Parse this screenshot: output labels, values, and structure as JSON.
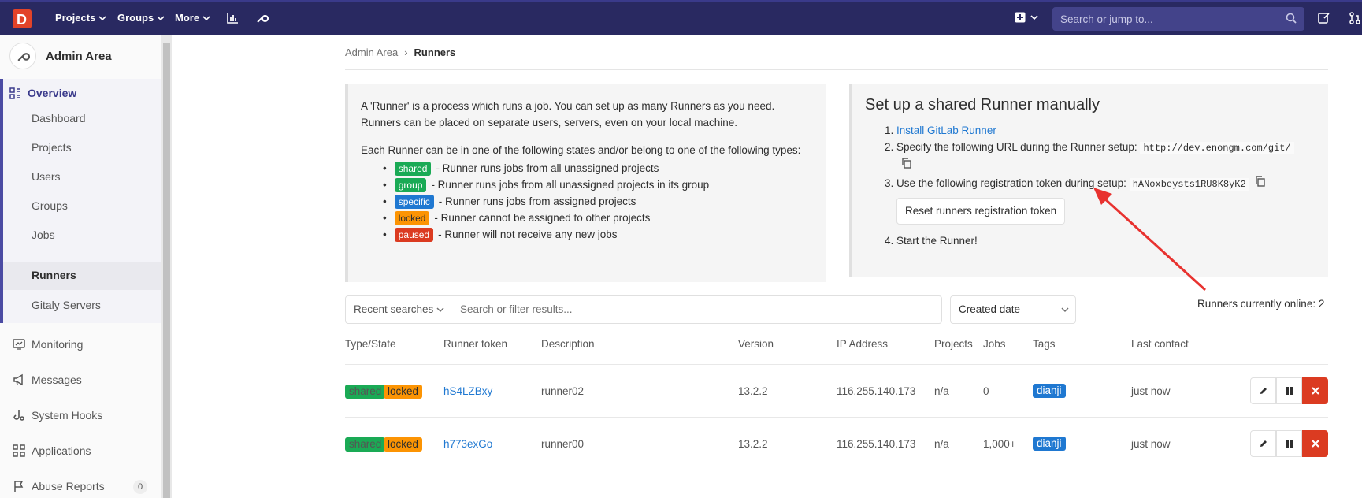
{
  "navbar": {
    "projects": "Projects",
    "groups": "Groups",
    "more": "More",
    "search_placeholder": "Search or jump to..."
  },
  "sidebar": {
    "title": "Admin Area",
    "overview": "Overview",
    "overview_items": [
      "Dashboard",
      "Projects",
      "Users",
      "Groups",
      "Jobs",
      "Runners",
      "Gitaly Servers"
    ],
    "active_item": "Runners",
    "main_items": [
      "Monitoring",
      "Messages",
      "System Hooks",
      "Applications",
      "Abuse Reports"
    ],
    "abuse_count": "0"
  },
  "breadcrumb": {
    "parent": "Admin Area",
    "current": "Runners"
  },
  "info": {
    "p1": "A 'Runner' is a process which runs a job. You can set up as many Runners as you need. Runners can be placed on separate users, servers, even on your local machine.",
    "p2": "Each Runner can be in one of the following states and/or belong to one of the following types:",
    "states": [
      {
        "badge": "shared",
        "text": "- Runner runs jobs from all unassigned projects"
      },
      {
        "badge": "group",
        "text": "- Runner runs jobs from all unassigned projects in its group"
      },
      {
        "badge": "specific",
        "text": "- Runner runs jobs from assigned projects"
      },
      {
        "badge": "locked",
        "text": "- Runner cannot be assigned to other projects"
      },
      {
        "badge": "paused",
        "text": "- Runner will not receive any new jobs"
      }
    ]
  },
  "setup": {
    "title": "Set up a shared Runner manually",
    "step1_link": "Install GitLab Runner",
    "step2_text": "Specify the following URL during the Runner setup:",
    "step2_url": "http://dev.enongm.com/git/",
    "step3_text": "Use the following registration token during setup:",
    "step3_token": "hANoxbeysts1RU8K8yK2",
    "reset_button": "Reset runners registration token",
    "step4_text": "Start the Runner!"
  },
  "filter": {
    "recent": "Recent searches",
    "placeholder": "Search or filter results...",
    "sort": "Created date",
    "online": "Runners currently online: 2"
  },
  "table": {
    "headers": [
      "Type/State",
      "Runner token",
      "Description",
      "Version",
      "IP Address",
      "Projects",
      "Jobs",
      "Tags",
      "Last contact"
    ],
    "rows": [
      {
        "badges": [
          "shared",
          "locked"
        ],
        "token": "hS4LZBxy",
        "description": "runner02",
        "version": "13.2.2",
        "ip": "116.255.140.173",
        "projects": "n/a",
        "jobs": "0",
        "tag": "dianji",
        "last_contact": "just now"
      },
      {
        "badges": [
          "shared",
          "locked"
        ],
        "token": "h773exGo",
        "description": "runner00",
        "version": "13.2.2",
        "ip": "116.255.140.173",
        "projects": "n/a",
        "jobs": "1,000+",
        "tag": "dianji",
        "last_contact": "just now"
      }
    ]
  },
  "colors": {
    "navbar": "#292961",
    "accent": "#4b4ba3",
    "link": "#1f78d1",
    "shared": "#1aaa55",
    "locked": "#fc9403",
    "paused": "#db3b21",
    "arrow": "#e8322f"
  },
  "icons": [
    "logo-icon",
    "chevron-down-icon",
    "chart-icon",
    "wrench-icon",
    "plus-square-icon",
    "search-icon",
    "todo-icon",
    "merge-request-icon",
    "overview-grid-icon",
    "monitor-icon",
    "megaphone-icon",
    "hook-icon",
    "apps-icon",
    "flag-icon",
    "copy-icon",
    "pencil-icon",
    "pause-icon",
    "close-icon"
  ]
}
